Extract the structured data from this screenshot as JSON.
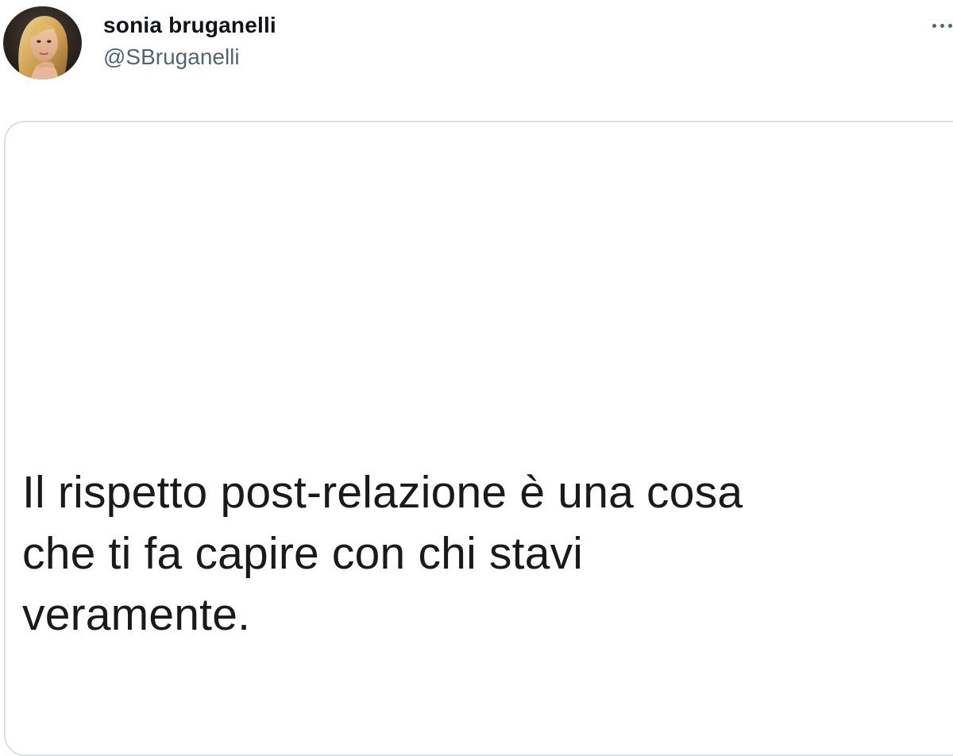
{
  "tweet": {
    "author": {
      "display_name": "sonia bruganelli",
      "handle": "@SBruganelli",
      "avatar_icon": "profile-photo"
    },
    "more_icon": "more-horizontal-icon",
    "media": {
      "text_lines": [
        "Il rispetto post-relazione è una cosa",
        "che ti fa capire con chi stavi",
        "veramente."
      ]
    }
  },
  "colors": {
    "background": "#ffffff",
    "name_text": "#0f1419",
    "handle_text": "#536471",
    "card_border": "#dcdfe2",
    "quote_text": "#1a1a1a"
  }
}
